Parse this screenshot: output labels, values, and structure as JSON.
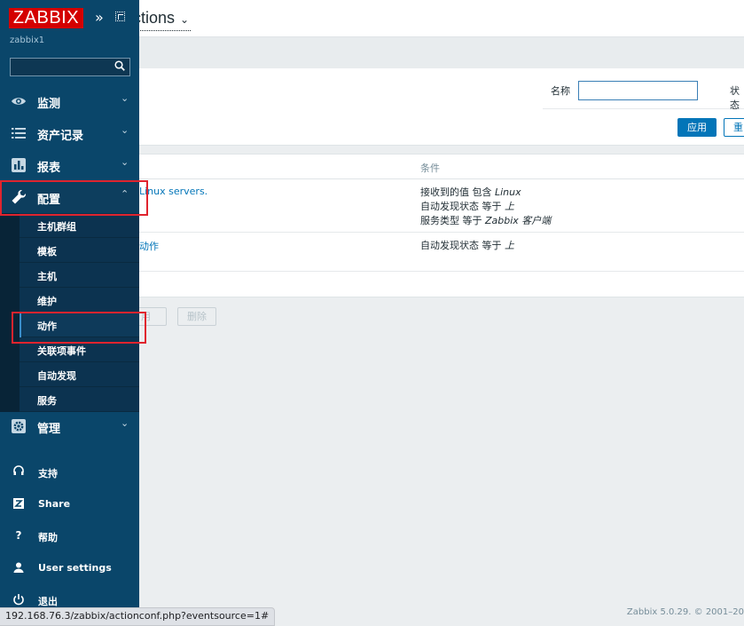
{
  "header": {
    "page_title": "ctions"
  },
  "filter": {
    "name_label": "名称",
    "status_label": "状态",
    "name_value": "",
    "apply_label": "应用",
    "reset_label": "重"
  },
  "table": {
    "columns": [
      "条件"
    ],
    "rows": [
      {
        "name": "Linux servers.",
        "conditions": [
          {
            "text": "接收到的值 包含 ",
            "value": "Linux"
          },
          {
            "text": "自动发现状态 等于 ",
            "value": "上"
          },
          {
            "text": "服务类型 等于 ",
            "value": "Zabbix 客户端"
          }
        ]
      },
      {
        "name": "动作",
        "conditions": [
          {
            "text": "自动发现状态 等于 ",
            "value": "上"
          }
        ]
      }
    ]
  },
  "mass_actions": {
    "enable_label": "用",
    "delete_label": "删除"
  },
  "footer": {
    "copyright": "Zabbix 5.0.29. © 2001–20"
  },
  "status_bar": {
    "url": "192.168.76.3/zabbix/actionconf.php?eventsource=1#"
  },
  "sidebar": {
    "logo": "ZABBIX",
    "server_name": "zabbix1",
    "search_value": "",
    "menu": [
      {
        "label": "监测",
        "icon": "eye-icon",
        "expanded": false
      },
      {
        "label": "资产记录",
        "icon": "list-icon",
        "expanded": false
      },
      {
        "label": "报表",
        "icon": "bar-chart-icon",
        "expanded": false
      },
      {
        "label": "配置",
        "icon": "wrench-icon",
        "expanded": true
      },
      {
        "label": "管理",
        "icon": "gear-icon",
        "expanded": false
      }
    ],
    "submenu": [
      "主机群组",
      "模板",
      "主机",
      "维护",
      "动作",
      "关联项事件",
      "自动发现",
      "服务"
    ],
    "current_submenu": "动作",
    "bottom": [
      {
        "label": "支持",
        "icon": "headset-icon"
      },
      {
        "label": "Share",
        "icon": "zabbix-share-icon"
      },
      {
        "label": "帮助",
        "icon": "help-icon"
      },
      {
        "label": "User settings",
        "icon": "user-icon"
      },
      {
        "label": "退出",
        "icon": "power-icon"
      }
    ]
  },
  "colors": {
    "sidebar_bg": "#0a466a",
    "accent": "#0275b8",
    "logo_red": "#d40000",
    "highlight_red": "#e0242e"
  }
}
